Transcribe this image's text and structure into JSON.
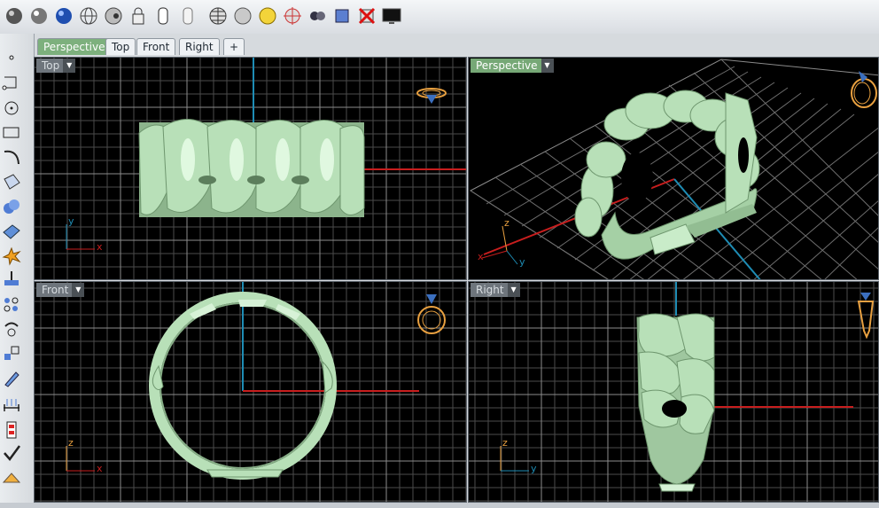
{
  "tabs": [
    {
      "label": "Perspective",
      "active": true
    },
    {
      "label": "Top",
      "active": false
    },
    {
      "label": "Front",
      "active": false
    },
    {
      "label": "Right",
      "active": false
    },
    {
      "label": "+",
      "active": false
    }
  ],
  "viewports": {
    "top": {
      "label": "Top",
      "axis_h": "x",
      "axis_v": "y"
    },
    "perspective": {
      "label": "Perspective",
      "axis_1": "x",
      "axis_2": "y",
      "axis_3": "z"
    },
    "front": {
      "label": "Front",
      "axis_h": "x",
      "axis_v": "z"
    },
    "right": {
      "label": "Right",
      "axis_h": "y",
      "axis_v": "z"
    }
  },
  "dropdown_glyph": "▼",
  "toolbar_icons": [
    "shaded-sphere-icon",
    "rendered-sphere-icon",
    "blue-sphere-icon",
    "wireframe-sphere-icon",
    "ghosted-sphere-icon",
    "lock-object-icon",
    "show-object-icon",
    "hide-object-icon",
    "grid-globe-icon",
    "sphere-icon",
    "light-bulb-icon",
    "target-icon",
    "camera-icon",
    "snapshot-icon",
    "disable-icon",
    "monitor-icon"
  ],
  "colors": {
    "model": "#b4ddb4",
    "x_axis": "#c81e1e",
    "y_axis": "#1e8cb4",
    "grid": "#5a5a5a",
    "active_tab": "#7db07d",
    "ring_icon": "#e8a040"
  }
}
